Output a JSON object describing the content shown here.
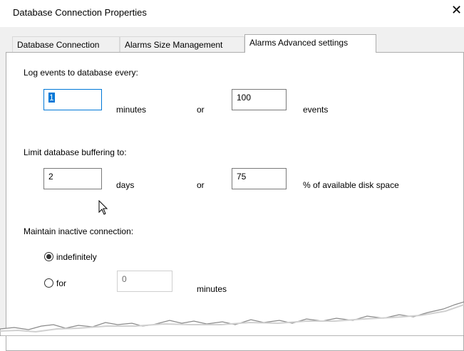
{
  "window": {
    "title": "Database Connection Properties",
    "close_glyph": "✕"
  },
  "tabs": [
    {
      "label": "Database Connection",
      "active": false
    },
    {
      "label": "Alarms Size Management",
      "active": false
    },
    {
      "label": "Alarms Advanced settings",
      "active": true
    }
  ],
  "log_events": {
    "heading": "Log events to database every:",
    "minutes_value": "1",
    "minutes_label": "minutes",
    "or_label": "or",
    "events_value": "100",
    "events_label": "events"
  },
  "buffering": {
    "heading": "Limit database buffering to:",
    "days_value": "2",
    "days_label": "days",
    "or_label": "or",
    "disk_value": "75",
    "disk_label": "% of available disk space"
  },
  "inactive": {
    "heading": "Maintain inactive connection:",
    "option_indefinitely": "indefinitely",
    "option_for": "for",
    "for_value": "0",
    "minutes_label": "minutes",
    "selected": "indefinitely"
  },
  "icons": {
    "mouse_cursor": "arrow-pointer-icon"
  }
}
